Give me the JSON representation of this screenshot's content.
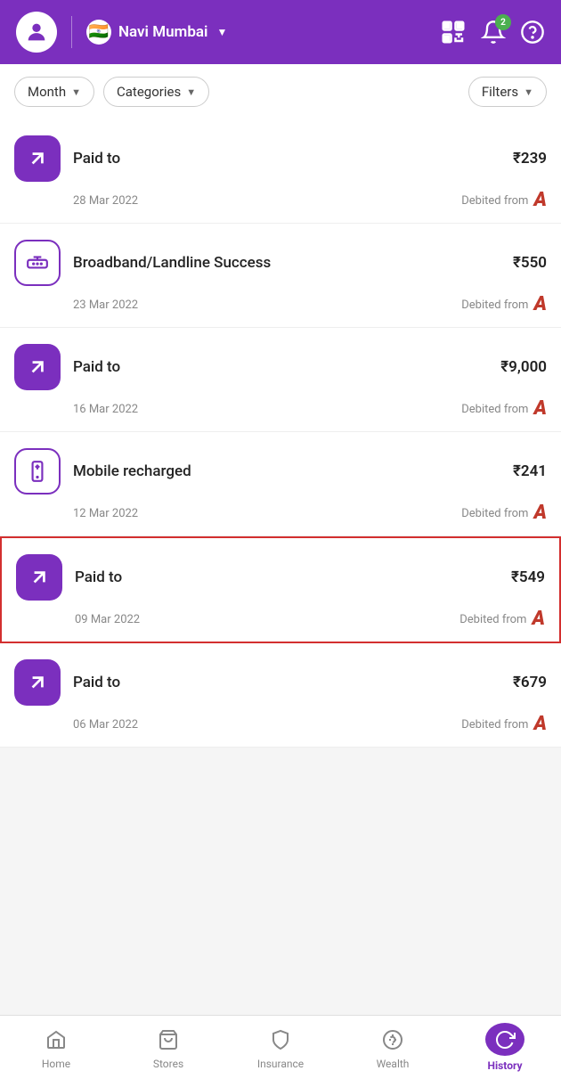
{
  "header": {
    "location": "Navi Mumbai",
    "flag_emoji": "🇮🇳",
    "notification_count": "2"
  },
  "filters": {
    "month_label": "Month",
    "categories_label": "Categories",
    "filters_label": "Filters"
  },
  "transactions": [
    {
      "id": 1,
      "icon_type": "arrow",
      "title": "Paid to",
      "amount": "₹239",
      "date": "28 Mar 2022",
      "debit_label": "Debited from",
      "highlighted": false
    },
    {
      "id": 2,
      "icon_type": "broadband",
      "title": "Broadband/Landline Success",
      "amount": "₹550",
      "date": "23 Mar 2022",
      "debit_label": "Debited from",
      "highlighted": false
    },
    {
      "id": 3,
      "icon_type": "arrow",
      "title": "Paid to",
      "amount": "₹9,000",
      "date": "16 Mar 2022",
      "debit_label": "Debited from",
      "highlighted": false
    },
    {
      "id": 4,
      "icon_type": "mobile",
      "title": "Mobile recharged",
      "amount": "₹241",
      "date": "12 Mar 2022",
      "debit_label": "Debited from",
      "highlighted": false
    },
    {
      "id": 5,
      "icon_type": "arrow",
      "title": "Paid to",
      "amount": "₹549",
      "date": "09 Mar 2022",
      "debit_label": "Debited from",
      "highlighted": true
    },
    {
      "id": 6,
      "icon_type": "arrow",
      "title": "Paid to",
      "amount": "₹679",
      "date": "06 Mar 2022",
      "debit_label": "Debited from",
      "highlighted": false
    }
  ],
  "nav": {
    "items": [
      {
        "id": "home",
        "label": "Home",
        "active": false
      },
      {
        "id": "stores",
        "label": "Stores",
        "active": false
      },
      {
        "id": "insurance",
        "label": "Insurance",
        "active": false
      },
      {
        "id": "wealth",
        "label": "Wealth",
        "active": false
      },
      {
        "id": "history",
        "label": "History",
        "active": true
      }
    ]
  }
}
